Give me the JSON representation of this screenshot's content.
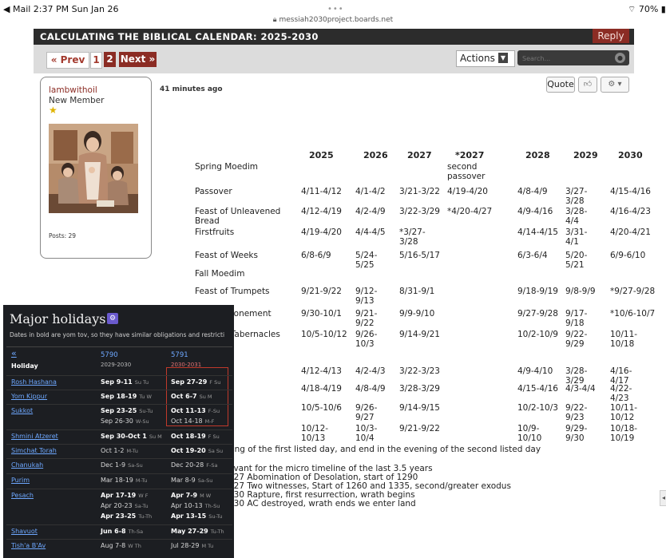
{
  "status": {
    "left": "◀ Mail  2:37 PM  Sun Jan 26",
    "right": "⌔ 70% ▮"
  },
  "url": "messiah2030project.boards.net",
  "forum": {
    "thread_title": "CALCULATING THE BIBLICAL CALENDAR: 2025-2030",
    "reply": "Reply",
    "prev": "« Prev",
    "page1": "1",
    "page2": "2",
    "next": "Next »",
    "actions": "Actions",
    "search_placeholder": "Search..."
  },
  "user": {
    "name": "lambwithoil",
    "role": "New Member",
    "posts": "Posts: 29"
  },
  "post": {
    "time": "41 minutes ago",
    "quote": "Quote"
  },
  "calendar": {
    "headers": [
      "2025",
      "2026",
      "2027",
      "*2027",
      "2028",
      "2029",
      "2030"
    ],
    "rows": [
      {
        "label": "Spring Moedim",
        "cells": [
          "",
          "",
          "",
          "second passover",
          "",
          "",
          ""
        ]
      },
      {
        "label": "Passover",
        "cells": [
          "4/11-4/12",
          "4/1-4/2",
          "3/21-3/22",
          "4/19-4/20",
          "4/8-4/9",
          "3/27-3/28",
          "4/15-4/16"
        ]
      },
      {
        "label": "Feast of Unleavened Bread",
        "cells": [
          "4/12-4/19",
          "4/2-4/9",
          "3/22-3/29",
          "*4/20-4/27",
          "4/9-4/16",
          "3/28-4/4",
          "4/16-4/23"
        ]
      },
      {
        "label": "Firstfruits",
        "cells": [
          "4/19-4/20",
          "4/4-4/5",
          "*3/27-3/28",
          "",
          "4/14-4/15",
          "3/31-4/1",
          "4/20-4/21"
        ]
      },
      {
        "label": "Feast of Weeks",
        "cells": [
          "6/8-6/9",
          "5/24-5/25",
          "5/16-5/17",
          "",
          "6/3-6/4",
          "5/20-5/21",
          "6/9-6/10"
        ]
      },
      {
        "label": "Fall Moedim",
        "cells": [
          "",
          "",
          "",
          "",
          "",
          "",
          ""
        ]
      },
      {
        "label": "Feast of Trumpets",
        "cells": [
          "9/21-9/22",
          "9/12-9/13",
          "8/31-9/1",
          "",
          "9/18-9/19",
          "9/8-9/9",
          "*9/27-9/28"
        ]
      },
      {
        "label": "Day of Atonement",
        "cells": [
          "9/30-10/1",
          "9/21-9/22",
          "9/9-9/10",
          "",
          "9/27-9/28",
          "9/17-9/18",
          "*10/6-10/7"
        ]
      },
      {
        "label": "Feast of Tabernacles",
        "cells": [
          "10/5-10/12",
          "9/26-10/3",
          "9/14-9/21",
          "",
          "10/2-10/9",
          "9/22-9/29",
          "10/11-10/18"
        ]
      },
      {
        "label": "",
        "cells": [
          "4/12-4/13",
          "4/2-4/3",
          "3/22-3/23",
          "",
          "4/9-4/10",
          "3/28-3/29",
          "4/16-4/17"
        ]
      },
      {
        "label": "",
        "cells": [
          "4/18-4/19",
          "4/8-4/9",
          "3/28-3/29",
          "",
          "4/15-4/16",
          "4/3-4/4",
          "4/22-4/23"
        ]
      },
      {
        "label": "",
        "cells": [
          "10/5-10/6",
          "9/26-9/27",
          "9/14-9/15",
          "",
          "10/2-10/3",
          "9/22-9/23",
          "10/11-10/12"
        ]
      },
      {
        "label": "",
        "cells": [
          "10/12-10/13",
          "10/3-10/4",
          "9/21-9/22",
          "",
          "10/9-10/10",
          "9/29-9/30",
          "10/18-10/19"
        ]
      }
    ]
  },
  "footer": [
    "ning of the first listed day, and end in the evening of the second listed day",
    "evant for the micro timeline of the last 3.5 years",
    "027 Abomination of Desolation, start of 1290",
    "027 Two witnesses, Start of 1260 and 1335, second/greater exodus",
    "030 Rapture, first resurrection, wrath begins",
    "030 AC destroyed, wrath ends we enter land"
  ],
  "major": {
    "title": "Major holidays",
    "subtitle": "Dates in bold are yom tov, so they have similar obligations and restricti",
    "back": "«",
    "holiday_header": "Holiday",
    "col1_year": "5790",
    "col1_range": "2029-2030",
    "col2_year": "5791",
    "col2_range": "2030-2031",
    "rows": [
      {
        "name": "Rosh Hashana",
        "c1": "Sep 9-11",
        "c1d": "Su Tu",
        "c2": "Sep 27-29",
        "c2d": "F Su"
      },
      {
        "name": "Yom Kippur",
        "c1": "Sep 18-19",
        "c1d": "Tu W",
        "c2": "Oct 6-7",
        "c2d": "Su M"
      },
      {
        "name": "Sukkot",
        "c1": "Sep 23-25",
        "c1d": "Su-Tu",
        "c2": "Oct 11-13",
        "c2d": "F-Su"
      },
      {
        "name": "",
        "c1": "Sep 26-30",
        "c1d": "W-Su",
        "c2": "Oct 14-18",
        "c2d": "M-F"
      },
      {
        "name": "Shmini Atzeret",
        "c1": "Sep 30-Oct 1",
        "c1d": "Su M",
        "c2": "Oct 18-19",
        "c2d": "F Su"
      },
      {
        "name": "Simchat Torah",
        "c1": "Oct 1-2",
        "c1d": "M-Tu",
        "c2": "Oct 19-20",
        "c2d": "Sa Su"
      },
      {
        "name": "Chanukah",
        "c1": "Dec 1-9",
        "c1d": "Sa-Su",
        "c2": "Dec 20-28",
        "c2d": "F-Sa"
      },
      {
        "name": "Purim",
        "c1": "Mar 18-19",
        "c1d": "M-Tu",
        "c2": "Mar 8-9",
        "c2d": "Sa-Su"
      },
      {
        "name": "Pesach",
        "c1": "Apr 17-19",
        "c1d": "W F",
        "c2": "Apr 7-9",
        "c2d": "M W"
      },
      {
        "name": "",
        "c1": "Apr 20-23",
        "c1d": "Sa-Tu",
        "c2": "Apr 10-13",
        "c2d": "Th-Su"
      },
      {
        "name": "",
        "c1": "Apr 23-25",
        "c1d": "Tu-Th",
        "c2": "Apr 13-15",
        "c2d": "Su-Tu"
      },
      {
        "name": "Shavuot",
        "c1": "Jun 6-8",
        "c1d": "Th-Sa",
        "c2": "May 27-29",
        "c2d": "Tu-Th"
      },
      {
        "name": "Tish'a B'Av",
        "c1": "Aug 7-8",
        "c1d": "W Th",
        "c2": "Jul 28-29",
        "c2d": "M Tu"
      }
    ]
  }
}
